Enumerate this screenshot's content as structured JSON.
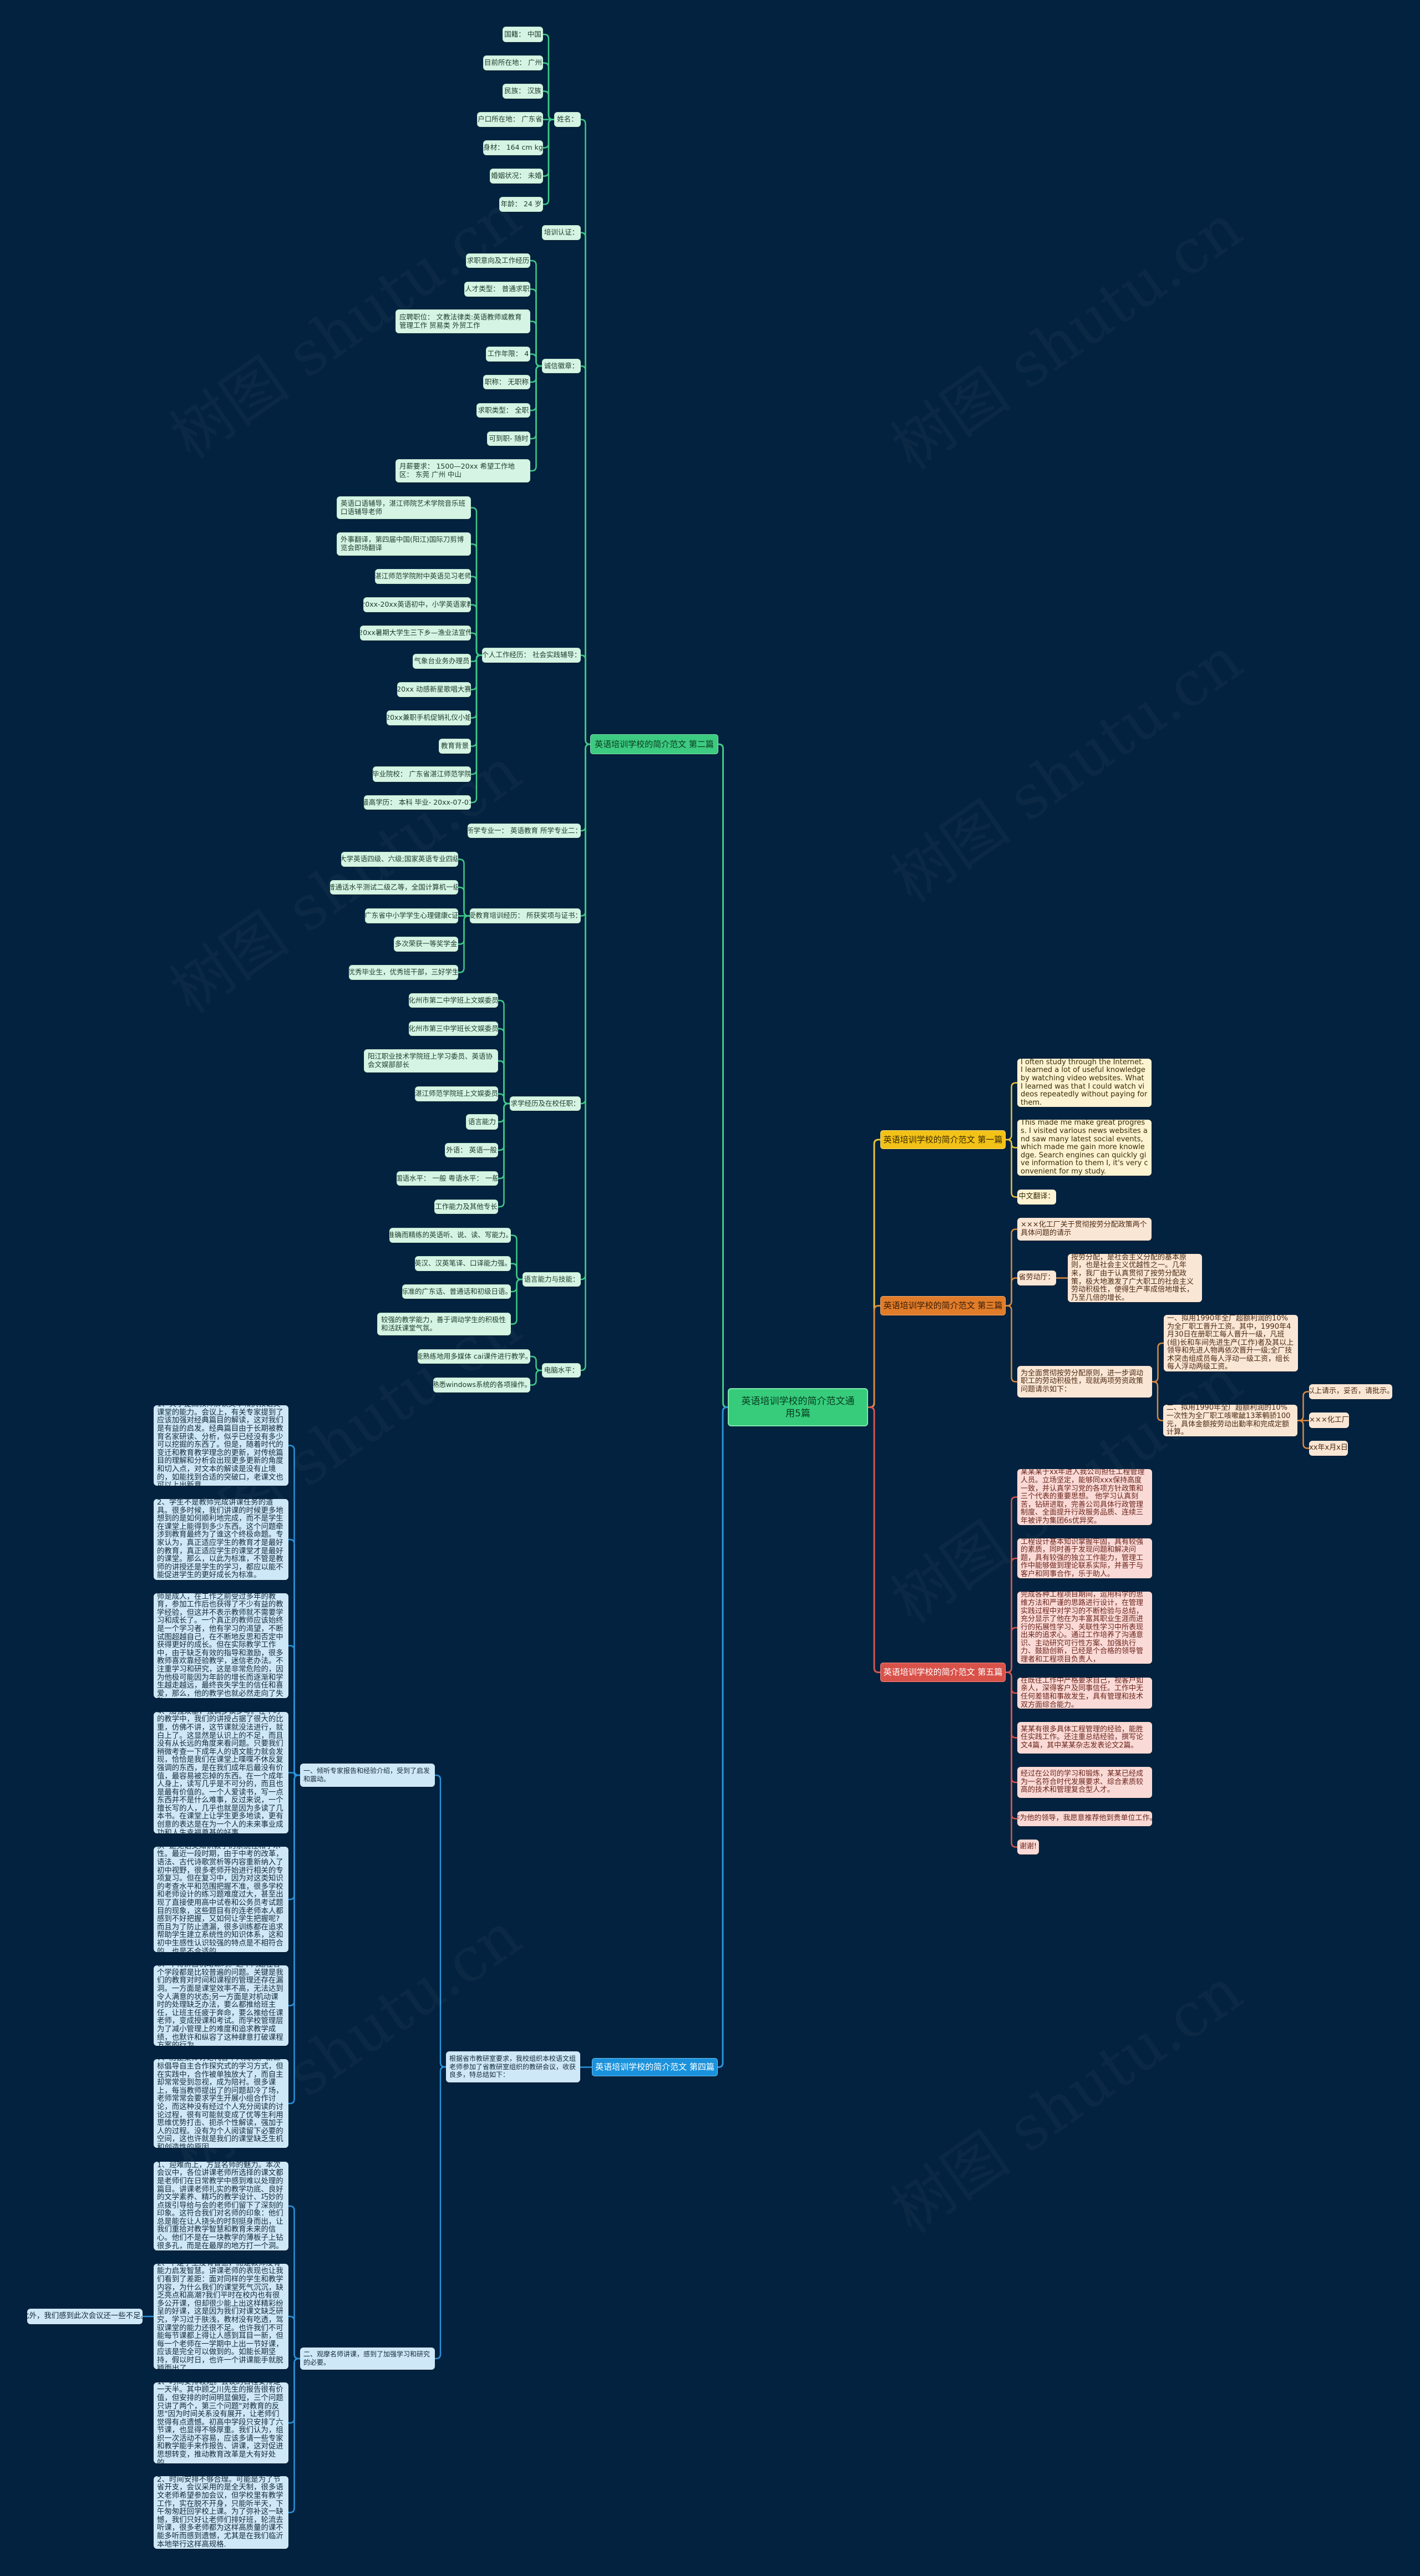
{
  "watermark": "树图 shutu.cn",
  "center": {
    "text": "英语培训学校的简介范文通用5篇",
    "color": "#36cc7c"
  },
  "branches": [
    {
      "label": "英语培训学校的简介范文 第一篇",
      "color": "#f2c218",
      "children": [
        {
          "text": "I often study through the Internet. I learned a lot of useful knowledge by watching video websites. What I learned was that I could watch videos repeatedly without paying for them."
        },
        {
          "text": "This made me make great progress. I visited various news websites and saw many latest social events, which made me gain more knowledge. Search engines can quickly give information to them I, it's very convenient for my study."
        },
        {
          "text": "中文翻译："
        }
      ]
    },
    {
      "label": "英语培训学校的简介范文 第二篇",
      "color": "#3ccb80",
      "children": [
        {
          "text": "姓名：",
          "children": [
            {
              "text": "国籍： 中国"
            },
            {
              "text": "目前所在地： 广州"
            },
            {
              "text": "民族： 汉族"
            },
            {
              "text": "户口所在地： 广东省"
            },
            {
              "text": "身材： 164 cm kg"
            },
            {
              "text": "婚姻状况： 未婚"
            },
            {
              "text": "年龄： 24 岁"
            }
          ]
        },
        {
          "text": "培训认证："
        },
        {
          "text": "诚信徽章：",
          "children": [
            {
              "text": "求职意向及工作经历"
            },
            {
              "text": "人才类型： 普通求职"
            },
            {
              "text": "应聘职位： 文教法律类:英语教师或教育管理工作 贸易类 外贸工作"
            },
            {
              "text": "工作年限： 4"
            },
            {
              "text": "职称： 无职称"
            },
            {
              "text": "求职类型： 全职"
            },
            {
              "text": "可到职- 随时"
            },
            {
              "text": "月薪要求： 1500—20xx 希望工作地区： 东莞 广州 中山"
            }
          ]
        },
        {
          "text": "个人工作经历： 社会实践辅导：",
          "children": [
            {
              "text": "英语口语辅导，湛江师院艺术学院音乐班口语辅导老师"
            },
            {
              "text": "外事翻译，第四届中国(阳江)国际刀剪博览会即场翻译"
            },
            {
              "text": "湛江师范学院附中英语见习老师"
            },
            {
              "text": "20xx-20xx英语初中，小学英语家教"
            },
            {
              "text": "20xx暑期大学生三下乡—渔业法宣传"
            },
            {
              "text": "气象台业务办理员"
            },
            {
              "text": "20xx 动感新星歌唱大赛"
            },
            {
              "text": "20xx兼职手机促销礼仪小姐"
            },
            {
              "text": "教育背景"
            },
            {
              "text": "毕业院校： 广东省湛江师范学院"
            },
            {
              "text": "最高学历： 本科 毕业- 20xx-07-01"
            }
          ]
        },
        {
          "text": "所学专业一： 英语教育 所学专业二："
        },
        {
          "text": "受教育培训经历： 所获奖项与证书：",
          "children": [
            {
              "text": "大学英语四级、六级;国家英语专业四级"
            },
            {
              "text": "普通话水平测试二级乙等，全国计算机一级"
            },
            {
              "text": "广东省中小学学生心理健康c证"
            },
            {
              "text": "多次荣获一等奖学金"
            },
            {
              "text": "优秀毕业生，优秀班干部，三好学生"
            }
          ]
        },
        {
          "text": "求学经历及在校任职：",
          "children": [
            {
              "text": "化州市第二中学班上文娱委员"
            },
            {
              "text": "化州市第三中学班长文娱委员"
            },
            {
              "text": "阳江职业技术学院班上学习委员、英语协会文娱部部长"
            },
            {
              "text": "湛江师范学院班上文娱委员"
            },
            {
              "text": "语言能力"
            },
            {
              "text": "外语： 英语一般"
            },
            {
              "text": "国语水平： 一般 粤语水平： 一般"
            },
            {
              "text": "工作能力及其他专长"
            }
          ]
        },
        {
          "text": "语言能力与技能：",
          "children": [
            {
              "text": "准确而精练的英语听、说、读、写能力。"
            },
            {
              "text": "英汉、汉英笔译、口译能力强。"
            },
            {
              "text": "标准的广东话、普通话和初级日语。"
            },
            {
              "text": "较强的教学能力，善于调动学生的积极性和活跃课堂气氛。"
            }
          ]
        },
        {
          "text": "电脑水平：",
          "children": [
            {
              "text": "能熟练地用多媒体 cai课件进行教学。"
            },
            {
              "text": "熟悉windows系统的各项操作。"
            }
          ]
        }
      ]
    },
    {
      "label": "英语培训学校的简介范文 第三篇",
      "color": "#e07c2a",
      "children": [
        {
          "text": "×××化工厂关于贯彻按劳分配政策两个具体问题的请示"
        },
        {
          "text": "省劳动厅：",
          "children": [
            {
              "text": "按劳分配，是社会主义分配的基本原则，也是社会主义优越性之一。几年来，我厂由于认真贯彻了按劳分配政策，极大地激发了广大职工的社会主义劳动积极性，使得生产率成倍地增长，乃至几倍的增长。"
            }
          ]
        },
        {
          "text": "为全面贯彻按劳分配原则，进一步调动职工的劳动积极性，现就两项劳资政策问题请示如下：",
          "children": [
            {
              "text": "一、拟用1990年全厂超额利润的10%为全厂职工晋升工资。其中，1990年4月30日在册职工每人晋升一级，凡班(组)长和车间先进生产(工作)者及其以上领导和先进人物再依次晋升一级;全厂技术突击组成员每人浮动一级工资，组长每人浮动两级工资。"
            },
            {
              "text": "二、拟用1990年全厂超额利润的10%一次性为全厂职工咳嗽龇13苯鹌骄100元，具体金额按劳动出勤率和完成定额计算。",
              "children": [
                {
                  "text": "以上请示，妥否，请批示。"
                },
                {
                  "text": "×××化工厂"
                },
                {
                  "text": "xx年x月x日"
                }
              ]
            }
          ]
        }
      ]
    },
    {
      "label": "英语培训学校的简介范文 第四篇",
      "color": "#1a92dc",
      "children": [
        {
          "text": "根据省市教研室要求，我校组织本校语文组老师参加了省教研室组织的教研会议，收获良多，特总结如下：",
          "children": [
            {
              "text": "一、倾听专家报告和经验介绍，受到了启发和震动。",
              "children": [
                {
                  "text": "1、关于提高教师解读文本和执教语文课堂的能力。会议上，有关专家提到了应该加强对经典篇目的解读，这对我们是有益的启发。经典篇目由于长期被教育名家研读、分析，似乎已经没有多少可以挖掘的东西了。但是，随着时代的变迁和教育教学理念的更新，对传统篇目的理解和分析会出现更多更新的角度和切入点，对文本的解读是没有止境的，如能找到合适的突破口，老课文也可以上出新意。"
                },
                {
                  "text": "2、学生不是教师完成讲课任务的道具。很多时候，我们讲课的时候更多地想到的是如何顺利地完成，而不是学生在课堂上能得到多少东西。这个问题牵涉到教育最终为了谁这个终极命题。专家认为，真正适应学生的教育才是最好的教育，真正适应学生的课堂才是最好的课堂。那么，以此为标准，不管是教师的讲授还是学生的学习，都应以能不能促进学生的更好成长为标准。"
                },
                {
                  "text": "3、让中青年教师重视自身的成长。教师是成人，在工作之前受过多年的教育，参加工作后也获得了不少有益的教学经验，但这并不表示教师就不需要学习和成长了。一个真正的教师应该始终是一个学习者，他有学习的渴望，不断试图超越自己，在不断地反思和否定中获得更好的成长。但在实际教学工作中，由于缺乏有效的指导和激励，很多教师喜欢靠经验教学，迷信老办法。不注重学习和研究，这是非常危险的，因为他极可能因为年龄的增长而逐渐和学生越走越远，最终丧失学生的信任和喜爱，那么，他的教学也就必然走向了失败。"
                },
                {
                  "text": "4、加强双基，强调多读多写。在平时的教学中，我们的讲授占据了很大的比重，仿佛不讲，这节课就没法进行，就白上了。这显然是认识上的不足，而且没有从长远的角度来看问题。只要我们稍微考查一下成年人的语文能力就会发现，恰恰是我们在课堂上喋喋不休反复强调的东西，是在我们成年后最没有价值，最容易被忘掉的东西。在一个成年人身上，读写几乎是不可分的，而且也是最有价值的。一个人爱读书，写一点东西并不是什么难事，反过来说，一个擅长写的人，几乎也就是因为多读了几本书。在课堂上让学生更多地读，更有创意的表达是在为一个人的未来事业成功和人生幸福奠基的好事。"
                },
                {
                  "text": "5、避免语文知识教学的系统性和学术性。最近一段时期，由于中考的改革，语法、古代诗歌赏析等内容重新纳入了初中视野，很多老师开始进行相关的专项复习。但在复习中，因为对这类知识的考查水平和范围把握不准，很多学校和老师设计的练习题难度过大，甚至出现了直接使用高中试卷和公务员考试题目的现象，这些题目有的连老师本人都感到不好把握，又如何让学生把握呢?而且为了防止遗漏，很多训练都在追求帮助学生建立系统性的知识体系，这和初中生感性认识较强的特点是不相符合的，也是不合适的。"
                },
                {
                  "text": "6、不得挤占机动课时。这个问题在各个学段都是比较普遍的问题。关键是我们的教育对时间和课程的管理还存在漏洞。一方面是课堂效率不高，无法达到令人满意的状态;另一方面是对机动课时的处理缺乏办法，要么都推给班主任，让班主任疲于奔命，要么推给任课老师，变成授课和考试。而学校管理层为了减小管理上的难度和追求教学成绩，也默许和纵容了这种肆意打破课程方案的行为。"
                },
                {
                  "text": "7、防止集体讨论代替个人阅读。新课标倡导自主合作探究式的学习方式，但在实践中，合作被单独放大了，而自主却常常受到忽视，成为陪衬。很多课上，每当教师提出了的问题却冷了场，老师常常会要求学生开展小组合作讨论，而这种没有经过个人充分阅读的讨论过程，很有可能就变成了优等生利用思维优势打击、扼杀个性解读，强加于人的过程。没有为个人阅读留下必要的空间，这也许就是我们的课堂缺乏生机和创造性的原因。"
                }
              ]
            },
            {
              "text": "二、观摩名师讲课，感到了加强学习和研究的必要。",
              "children": [
                {
                  "text": "1、迎难而上，方显名师的魅力。本次会议中，各位讲课老师所选择的课文都是老师们在日常教学中感到难以处理的篇目。讲课老师扎实的教学功底、良好的文学素养、精巧的教学设计、巧妙的点拨引导给与会的老师们留下了深刻的印象。这符合我们对名师的印象：他们总是能在让人挠头的时刻挺身而出，让我们重拾对教学智慧和教育未来的信心。他们不是在一块教学的薄板子上钻很多孔，而是在最厚的地方打一个洞。"
                },
                {
                  "text": "2、不是学生没有智慧，而是教师没有能力启发智慧。讲课老师的表现也让我们看到了差距：面对同样的学生和教学内容，为什么我们的课堂死气沉沉，缺乏亮点和高潮?我们平时在校内也有很多公开课，但却很少能上出这样精彩纷呈的好课，这是因为我们对课文缺乏研究，学习过于肤浅，教材没有吃透，驾驭课堂的能力还很不足。也许我们不可能每节课都上得让人感到耳目一新，但每一个老师在一学期中上出一节好课，应该是完全可以做到的。如能长期坚持，假以时日，也许一个讲课能手就脱颖而出了。",
                  "children": [
                    {
                      "text": "此外，我们感到此次会议还一些不足。"
                    }
                  ]
                },
                {
                  "text": "1、时间安排较短。会议的日程安排是一天半。其中顾之川先生的报告很有价值，但安排的时间明显偏短，三个问题只讲了两个，第三个问题\"对教育的反思\"因为时间关系没有展开，让老师们觉得有点遗憾。初高中学段只安排了六节课，也显得不够厚重。我们认为，组织一次活动不容易，应该多请一些专家和教学能手来作报告、讲课，这对促进思想转变，推动教育改革是大有好处的。"
                },
                {
                  "text": "2、时间安排不够合理。可能是为了节省开支，会议采用的是全天制，很多语文老师希望参加会议，但学校里有教学工作，实在脱不开身，只能听半天，下午匆匆赶回学校上课。为了弥补这一缺憾，我们只好让老师们排好班，轮流去听课，很多老师都为这样高质量的课不能多听而感到遗憾，尤其是在我们临沂本地举行这样高规格."
                }
              ]
            }
          ]
        }
      ]
    },
    {
      "label": "英语培训学校的简介范文 第五篇",
      "color": "#d8524a",
      "children": [
        {
          "text": "某某某于xx年进入我公司担任工程管理人员。立场坚定，能够同xxx保持高度一致，并认真学习党的各项方针政策和三个代表的重要思想。 他学习认真刻苦，钻研进取，完善公司具体行政管理制度、全面提升行政服务品质、连续三年被评为集团6s优异奖。"
        },
        {
          "text": "工程设计基本知识掌握牢固，具有较强的素质，同时善于发现问题和解决问题，具有较强的独立工作能力，管理工作中能够做到理论联系实际，并善于与客户和同事合作，乐于助人。"
        },
        {
          "text": "完成各种工程项目期间，运用科学的思维方法和严谨的思路进行设计，在管理实践过程中对学习的不断检验与总结，充分显示了他在为丰富其职业生涯而进行的拓展性学习、关联性学习中所表现出来的追求心。通过工作培养了沟通意识、主动研究可行性方案、加强执行力、鼓励创新，已经是个合格的领导管理者和工程项目负责人，"
        },
        {
          "text": "在既往工作中严格要求自己，视客户如亲人，深得客户及同事信任。工作中无任何差错和事故发生，具有管理和技术双方面综合能力。"
        },
        {
          "text": "某某有很多具体工程管理的经验，能胜任实践工作。还注重总结经验，撰写论文4篇，其中某某杂志发表论文2篇。"
        },
        {
          "text": "经过在公司的学习和锻炼，某某已经成为一名符合时代发展要求、综合素质较高的技术和管理复合型人才。"
        },
        {
          "text": "作为他的领导，我愿意推荐他到贵单位工作。"
        },
        {
          "text": "谢谢!"
        }
      ]
    }
  ]
}
